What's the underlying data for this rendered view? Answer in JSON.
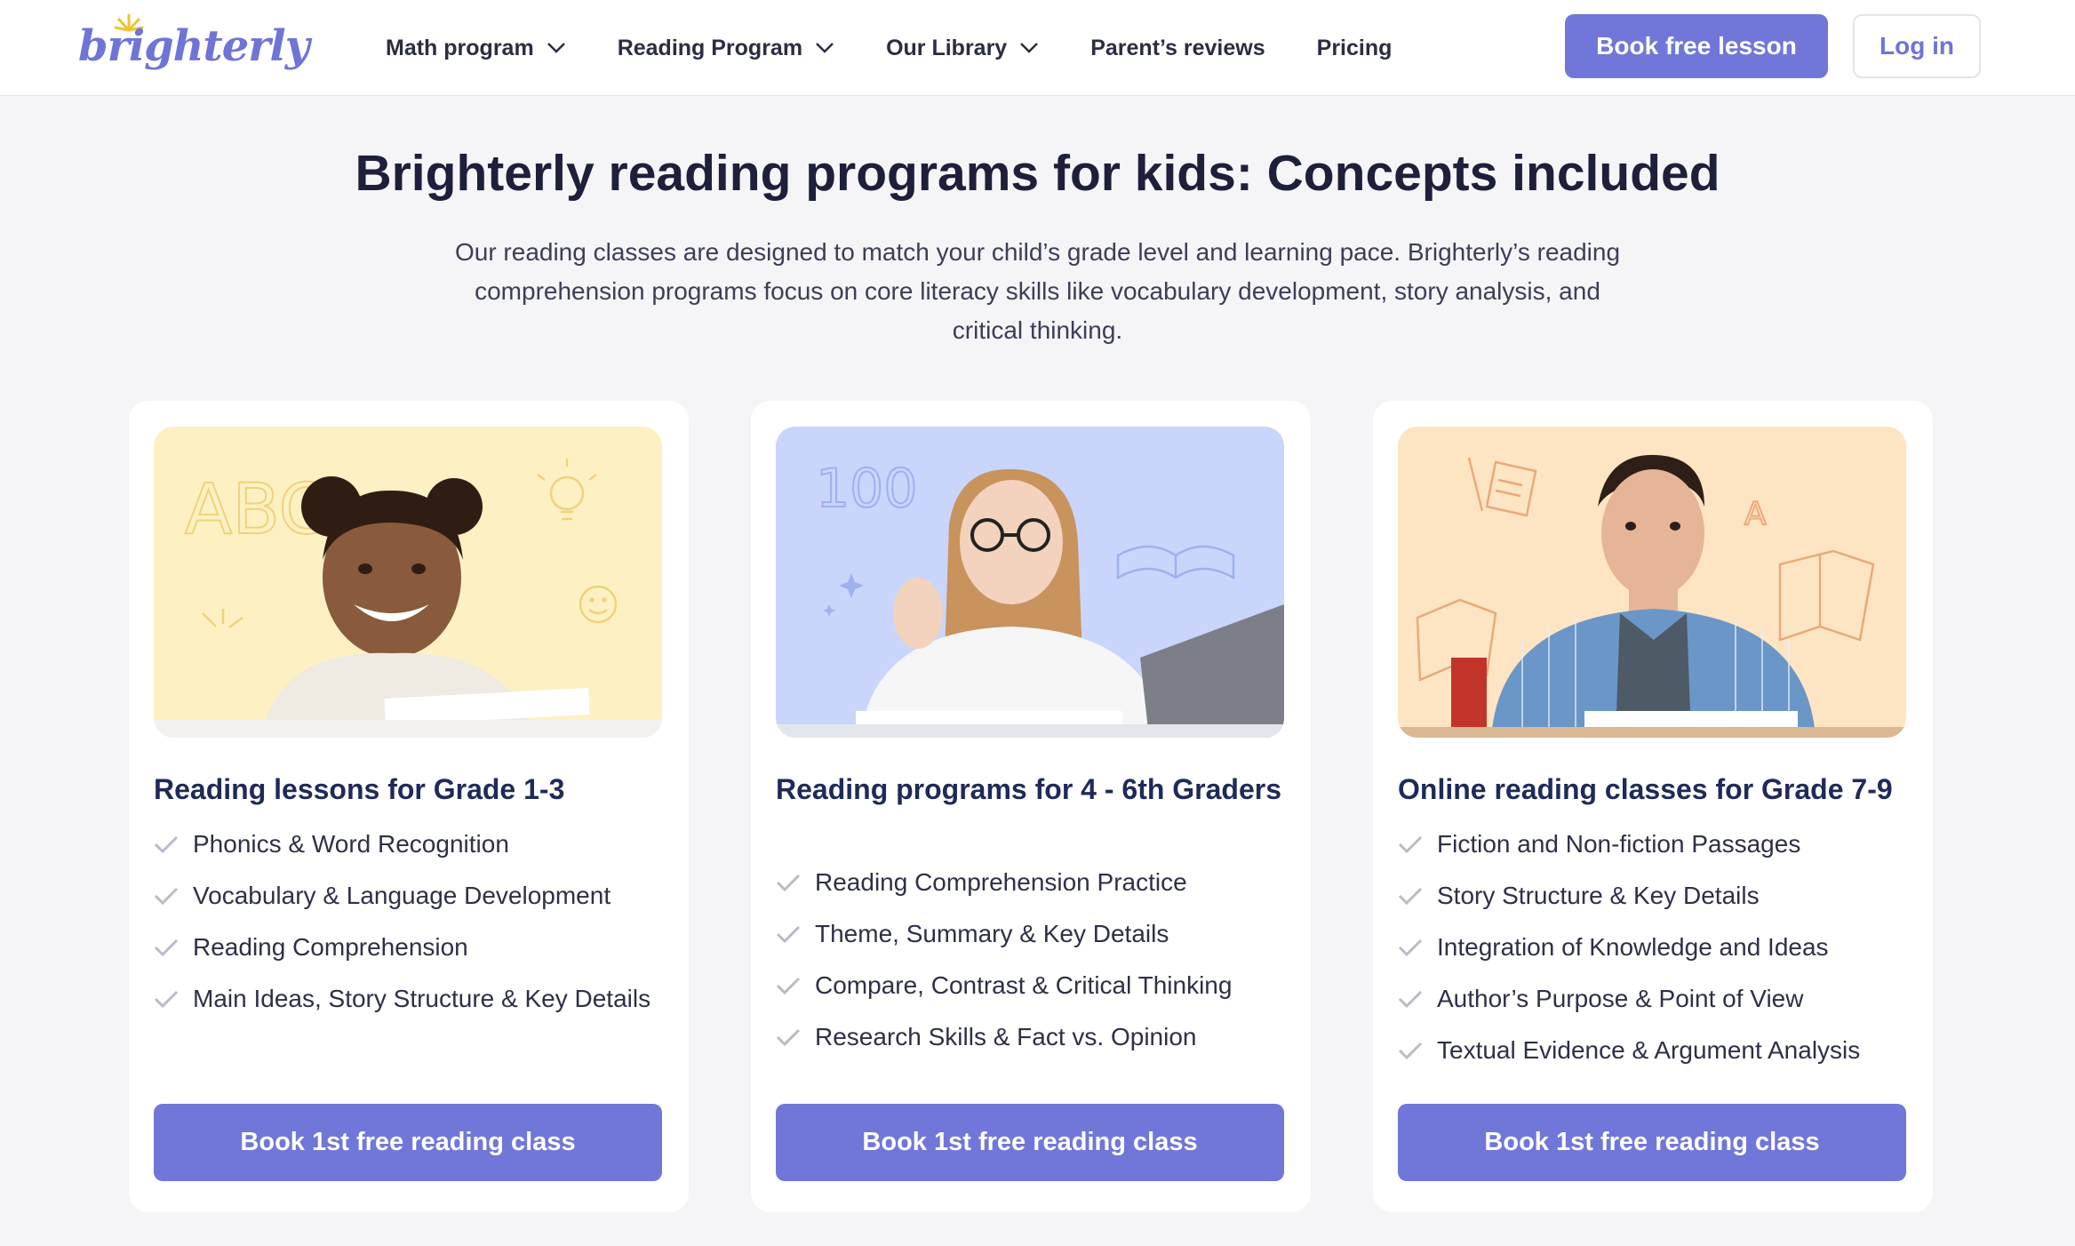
{
  "brand": {
    "logo_text": "brighterly",
    "accent": "#7177d8",
    "title_color": "#1f2a5a"
  },
  "nav": {
    "items": [
      {
        "label": "Math program",
        "has_dropdown": true
      },
      {
        "label": "Reading Program",
        "has_dropdown": true
      },
      {
        "label": "Our Library",
        "has_dropdown": true
      },
      {
        "label": "Parent’s reviews",
        "has_dropdown": false
      },
      {
        "label": "Pricing",
        "has_dropdown": false
      }
    ],
    "book_label": "Book free lesson",
    "login_label": "Log in"
  },
  "hero": {
    "title": "Brighterly reading programs for kids: Concepts included",
    "subtitle": "Our reading classes are designed to match your child’s grade level and learning pace. Brighterly’s reading comprehension programs focus on core literacy skills like vocabulary development, story analysis, and critical thinking."
  },
  "cards": [
    {
      "title": "Reading lessons for Grade 1-3",
      "image_bg": "#fdf1c4",
      "image_doodles": "ABC",
      "features": [
        "Phonics & Word Recognition",
        "Vocabulary & Language Development",
        "Reading Comprehension",
        "Main Ideas, Story Structure & Key Details"
      ],
      "button_label": "Book 1st free reading class"
    },
    {
      "title": "Reading programs for 4 - 6th Graders",
      "image_bg": "#c9d5fb",
      "image_doodles": "100",
      "features": [
        "Reading Comprehension Practice",
        "Theme, Summary & Key Details",
        "Compare, Contrast & Critical Thinking",
        "Research Skills & Fact vs. Opinion"
      ],
      "button_label": "Book 1st free reading class"
    },
    {
      "title": "Online reading classes for Grade 7-9",
      "image_bg": "#fde5c4",
      "image_doodles": "A",
      "features": [
        "Fiction and Non-fiction Passages",
        "Story Structure & Key Details",
        "Integration of Knowledge and Ideas",
        "Author’s Purpose & Point of View",
        "Textual Evidence & Argument Analysis"
      ],
      "button_label": "Book 1st free reading class"
    }
  ]
}
